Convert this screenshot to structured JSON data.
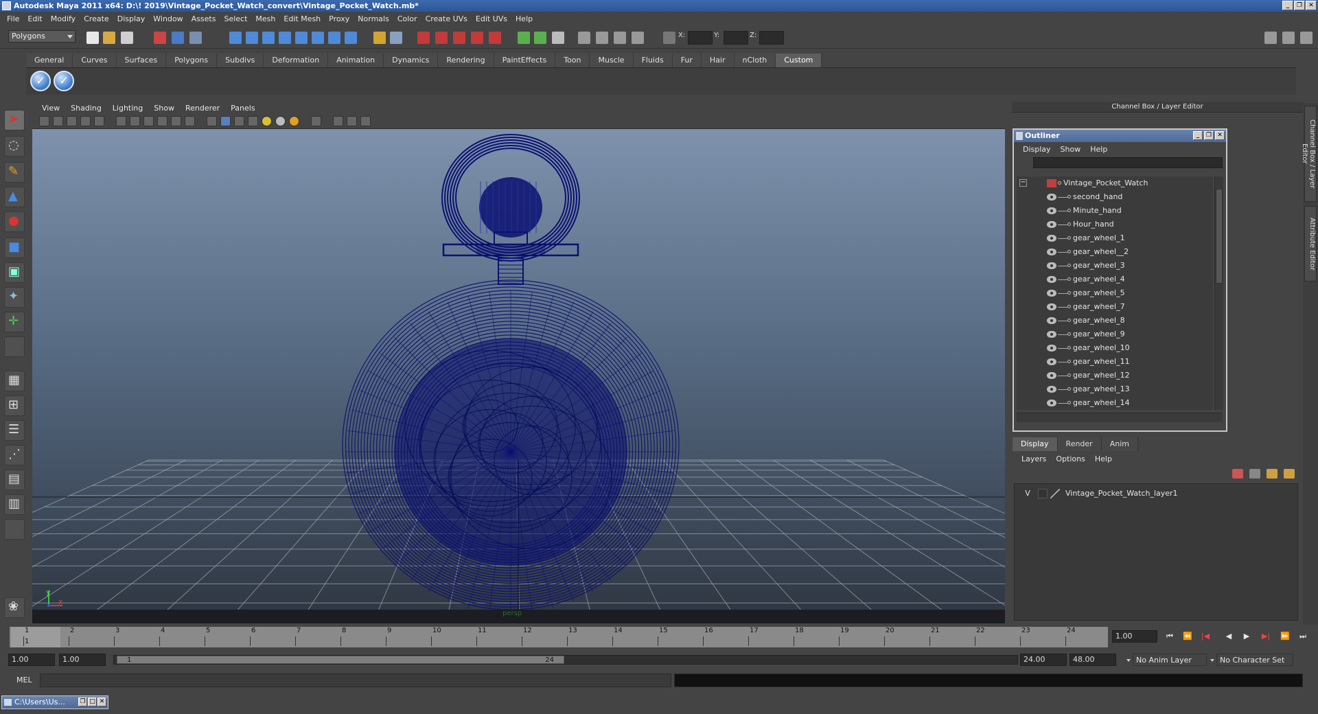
{
  "window": {
    "title": "Autodesk Maya 2011 x64: D:\\! 2019\\Vintage_Pocket_Watch_convert\\Vintage_Pocket_Watch.mb*",
    "minimize": "_",
    "restore": "❐",
    "close": "✕"
  },
  "menubar": [
    "File",
    "Edit",
    "Modify",
    "Create",
    "Display",
    "Window",
    "Assets",
    "Select",
    "Mesh",
    "Edit Mesh",
    "Proxy",
    "Normals",
    "Color",
    "Create UVs",
    "Edit UVs",
    "Help"
  ],
  "statusline": {
    "mode": "Polygons",
    "x_label": "X:",
    "y_label": "Y:",
    "z_label": "Z:"
  },
  "shelf": {
    "tabs": [
      "General",
      "Curves",
      "Surfaces",
      "Polygons",
      "Subdivs",
      "Deformation",
      "Animation",
      "Dynamics",
      "Rendering",
      "PaintEffects",
      "Toon",
      "Muscle",
      "Fluids",
      "Fur",
      "Hair",
      "nCloth",
      "Custom"
    ],
    "active_tab": "Custom",
    "check_glyph": "✓"
  },
  "viewport": {
    "menu": [
      "View",
      "Shading",
      "Lighting",
      "Show",
      "Renderer",
      "Panels"
    ],
    "camera_label": "persp",
    "axis_y": "y",
    "axis_x": "x"
  },
  "channel_box": {
    "title": "Channel Box / Layer Editor",
    "side_tabs": [
      "Channel Box / Layer Editor",
      "Attribute Editor"
    ]
  },
  "outliner": {
    "title": "Outliner",
    "minimize": "_",
    "restore": "❐",
    "close": "✕",
    "menu": [
      "Display",
      "Show",
      "Help"
    ],
    "root": "Vintage_Pocket_Watch",
    "collapse_glyph": "−",
    "items": [
      "second_hand",
      "Minute_hand",
      "Hour_hand",
      "gear_wheel_1",
      "gear_wheel__2",
      "gear_wheel_3",
      "gear_wheel_4",
      "gear_wheel_5",
      "gear_wheel_7",
      "gear_wheel_8",
      "gear_wheel_9",
      "gear_wheel_10",
      "gear_wheel_11",
      "gear_wheel_12",
      "gear_wheel_13",
      "gear_wheel_14"
    ]
  },
  "layer_editor": {
    "tabs": [
      "Display",
      "Render",
      "Anim"
    ],
    "active_tab": "Display",
    "menu": [
      "Layers",
      "Options",
      "Help"
    ],
    "layer": {
      "visible": "V",
      "name": "Vintage_Pocket_Watch_layer1"
    }
  },
  "time_slider": {
    "ticks": [
      1,
      2,
      3,
      4,
      5,
      6,
      7,
      8,
      9,
      10,
      11,
      12,
      13,
      14,
      15,
      16,
      17,
      18,
      19,
      20,
      21,
      22,
      23,
      24
    ],
    "current_frame": "1",
    "current_time": "1.00",
    "playback": [
      "⏮",
      "⏪",
      "|◀",
      "◀",
      "▶",
      "▶|",
      "⏩",
      "⏭"
    ]
  },
  "range_slider": {
    "start_time": "1.00",
    "playback_start": "1.00",
    "range_start": "1",
    "range_end": "24",
    "playback_end": "24.00",
    "end_time": "48.00",
    "anim_layer": "No Anim Layer",
    "character_set": "No Character Set"
  },
  "command_line": {
    "label": "MEL"
  },
  "taskbar": {
    "window_title": "C:\\Users\\Us...",
    "restore": "❐",
    "maximize": "□",
    "close": "✕"
  },
  "colors": {
    "wireframe": "#0b1070",
    "grid": "#9ca3ad",
    "viewport_top": "#7e92ad",
    "viewport_bottom": "#2e3540"
  }
}
